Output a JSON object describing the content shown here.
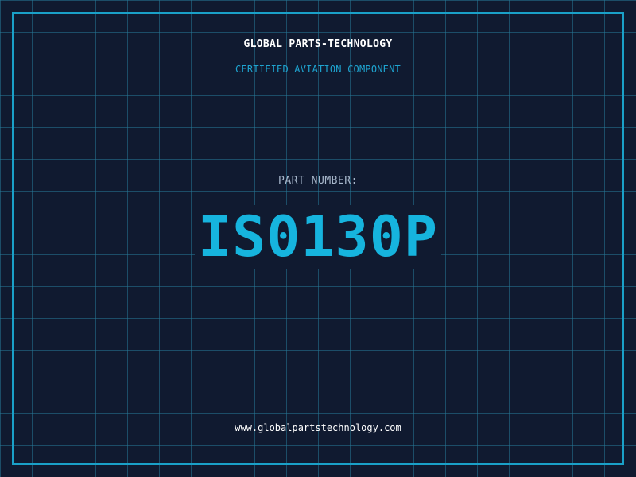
{
  "header": {
    "company_name": "GLOBAL PARTS-TECHNOLOGY",
    "tagline": "CERTIFIED AVIATION COMPONENT"
  },
  "part": {
    "label": "PART NUMBER:",
    "number": "IS0130P"
  },
  "footer": {
    "website": "www.globalpartstechnology.com"
  },
  "colors": {
    "background": "#101a30",
    "grid": "#267696",
    "frame": "#1aa0c8",
    "accent": "#16b4de",
    "label": "#a8b8cc",
    "text": "#ffffff"
  }
}
